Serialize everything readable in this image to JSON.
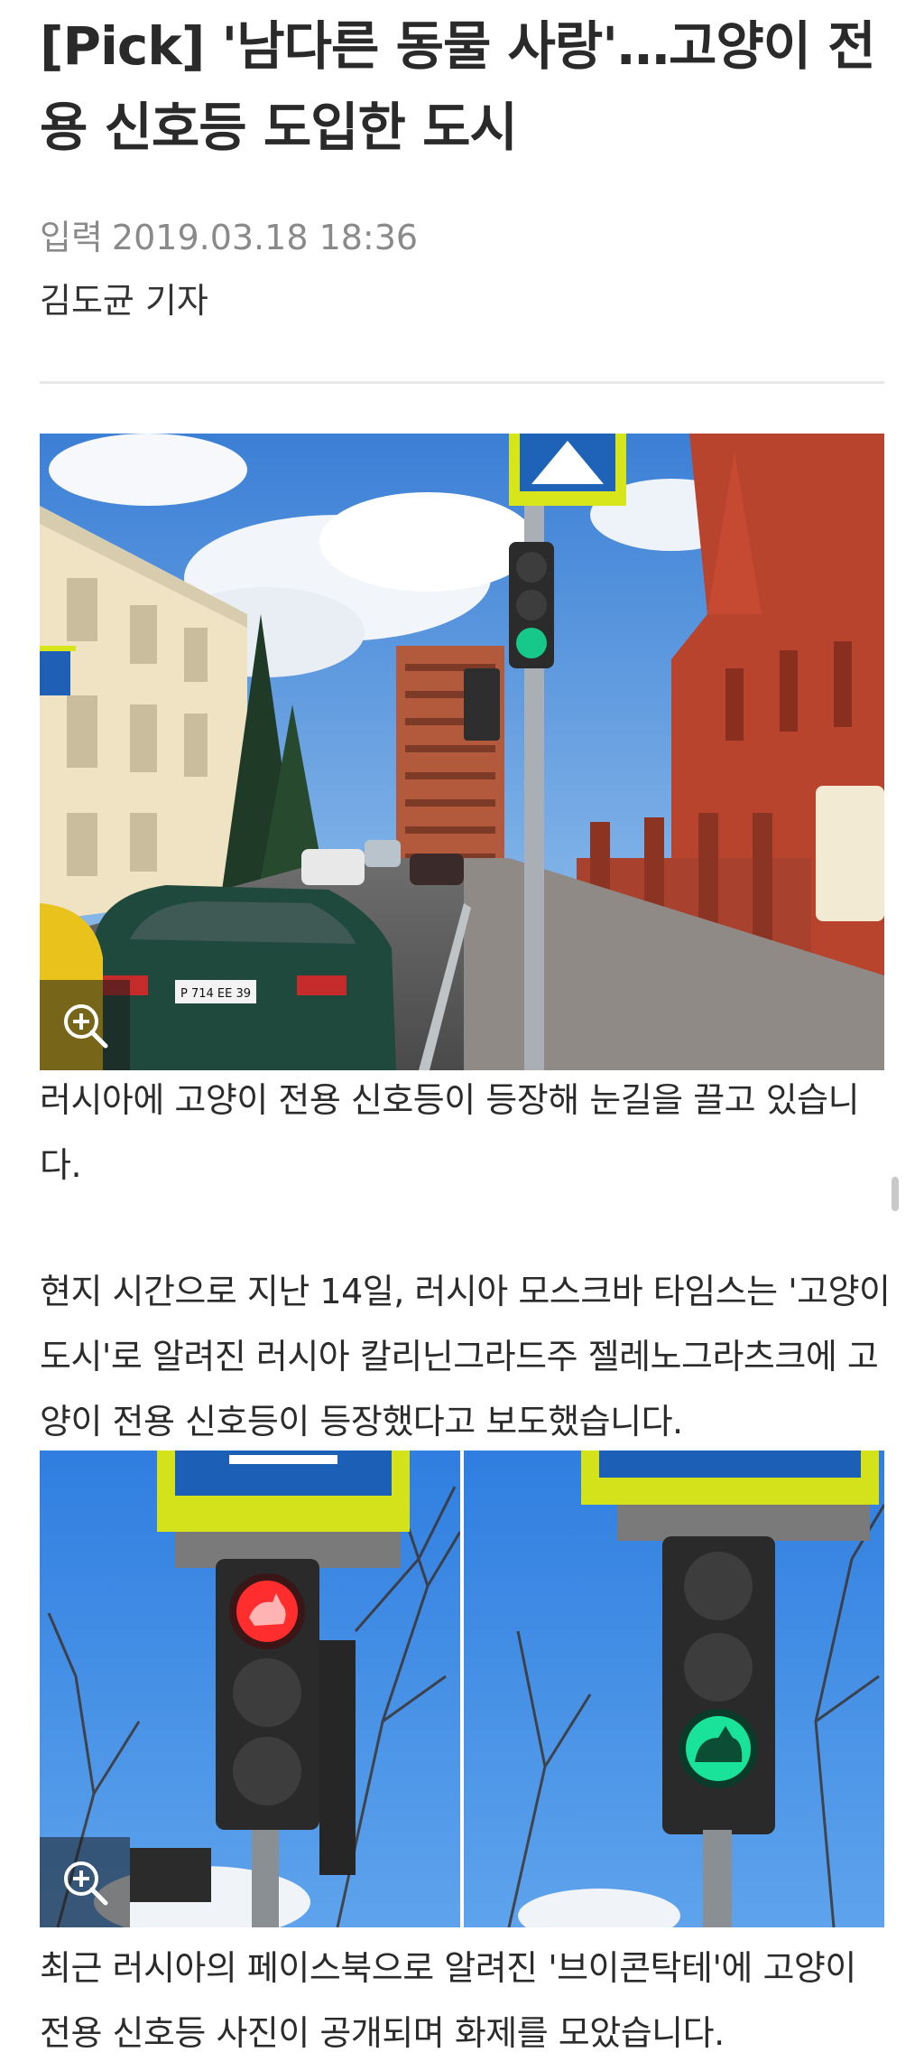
{
  "article": {
    "title": "[Pick] '남다른 동물 사랑'…고양이 전용 신호등 도입한 도시",
    "date_label": "입력",
    "date_value": "2019.03.18 18:36",
    "reporter": "김도균 기자"
  },
  "photo1": {
    "plate": "P 714 EE 39"
  },
  "captions": {
    "photo1": "러시아에 고양이 전용 신호등이 등장해 눈길을 끌고 있습니다.",
    "body1": "현지 시간으로 지난 14일, 러시아 모스크바 타임스는 '고양이 도시'로 알려진 러시아 칼리닌그라드주 젤레노그라츠크에 고양이 전용 신호등이 등장했다고 보도했습니다.",
    "photo2": "최근 러시아의 페이스북으로 알려진 '브이콘탁테'에 고양이 전용 신호등 사진이 공개되며 화제를 모았습니다."
  },
  "icons": {
    "zoom": "zoom-in-icon"
  },
  "colors": {
    "title": "#2a2a2a",
    "meta": "#8a8a8a",
    "text": "#2b2b2b",
    "signal_red": "#ff2d2d",
    "signal_green": "#19e39a"
  }
}
